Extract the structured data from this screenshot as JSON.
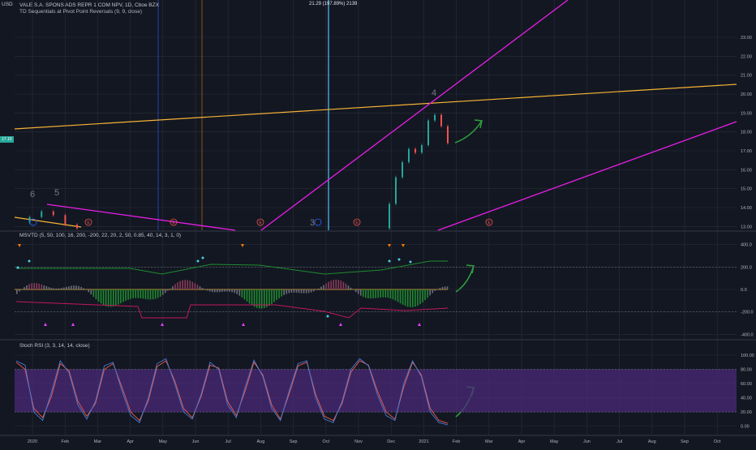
{
  "header": {
    "currency": "USD",
    "symbol_line": "VALE S.A. SPONS ADS REPR 1 COM NPV, 1D, Cboe BZX",
    "indicator_line": "TD Sequentials at Pivot Point Reversals (9, 9, close)",
    "price_flag": "17.10",
    "top_measure": "21.29 (197.89%) 2139"
  },
  "chart_data": [
    {
      "type": "line",
      "panel": "price",
      "title": "VALE S.A. SPONS ADS REPR 1 COM NPV, 1D, Cboe BZX",
      "x": [
        "2020",
        "Feb",
        "Mar",
        "Apr",
        "May",
        "Jun",
        "Jul",
        "Aug",
        "Sep",
        "Oct",
        "Nov",
        "Dec",
        "2021",
        "Feb",
        "Mar",
        "Apr",
        "May",
        "Jun",
        "Jul",
        "Aug",
        "Sep",
        "Oct"
      ],
      "y_ticks": [
        "23.00",
        "22.00",
        "21.00",
        "20.00",
        "19.00",
        "18.00",
        "17.00",
        "16.00",
        "15.00",
        "14.00",
        "13.00"
      ],
      "ylim": [
        12.8,
        24.2
      ],
      "series": [
        {
          "values": [
            13.2,
            13.5,
            13.8,
            13.6,
            13.1,
            12.9
          ]
        },
        {
          "values": [
            12.9,
            14.2,
            15.6,
            16.4,
            17.1,
            16.9,
            17.3,
            18.6,
            18.9,
            18.3,
            17.4
          ]
        }
      ],
      "annotations": [
        "6",
        "5",
        "3",
        "4",
        "E",
        "E",
        "E",
        "E",
        "E",
        "E"
      ]
    },
    {
      "type": "bar",
      "panel": "msvtd",
      "title": "MSVTD (5, 50, 100, 16, 200, -200, 22, 20, 2, 50, 0.85, 40, 14, 3, 1, 0)",
      "y_ticks": [
        "400.0",
        "200.0",
        "0.0",
        "-200.0",
        "-400.0"
      ],
      "ylim": [
        -440,
        440
      ]
    },
    {
      "type": "line",
      "panel": "stoch",
      "title": "Stoch RSI (3, 3, 14, 14, close)",
      "y_ticks": [
        "100.00",
        "80.00",
        "60.00",
        "40.00",
        "20.00",
        "0.00"
      ],
      "ylim": [
        -5,
        108
      ],
      "series": [
        {
          "values": [
            92,
            86,
            20,
            8,
            48,
            92,
            75,
            30,
            10,
            35,
            85,
            90,
            50,
            15,
            5,
            40,
            88,
            95,
            60,
            20,
            10,
            45,
            90,
            80,
            30,
            12,
            55,
            93,
            70,
            25,
            8,
            50,
            88,
            92,
            40,
            10,
            5,
            35,
            80,
            95,
            85,
            45,
            15,
            8,
            60,
            92,
            70,
            20,
            5,
            2
          ]
        },
        {
          "values": [
            90,
            80,
            25,
            12,
            42,
            88,
            78,
            35,
            14,
            32,
            80,
            88,
            55,
            20,
            8,
            36,
            84,
            92,
            64,
            25,
            12,
            42,
            86,
            82,
            35,
            15,
            50,
            90,
            72,
            30,
            10,
            46,
            85,
            90,
            45,
            14,
            8,
            32,
            76,
            92,
            86,
            50,
            20,
            10,
            55,
            90,
            72,
            25,
            8,
            4
          ]
        }
      ]
    }
  ],
  "colors": {
    "background": "#131722",
    "grid": "#2a2e39",
    "up": "#26a69a",
    "down": "#ef5350",
    "magenta": "#e91ee6",
    "orange_line": "#f5b335",
    "green_arrow": "#2e9e3e",
    "stoch_k": "#4a7bd6",
    "stoch_d": "#f05d4a",
    "stoch_band": "#4b2a7a"
  }
}
